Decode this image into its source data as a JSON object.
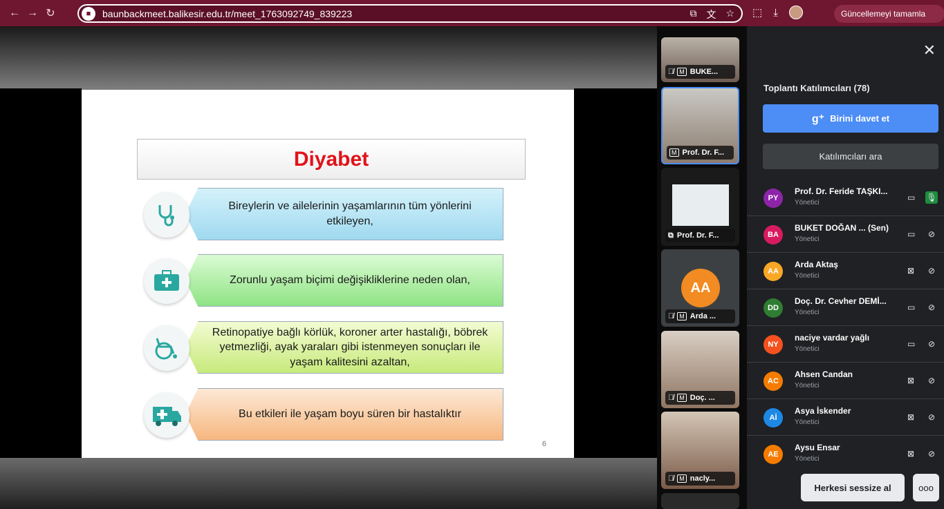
{
  "browser": {
    "url": "baunbackmeet.balikesir.edu.tr/meet_1763092749_839223",
    "update_label": "Güncellemeyi tamamla"
  },
  "slide": {
    "title": "Diyabet",
    "items": [
      "Bireylerin ve ailelerinin yaşamlarının tüm yönlerini etkileyen,",
      "Zorunlu yaşam biçimi değişikliklerine neden olan,",
      "Retinopatiye bağlı körlük, koroner arter hastalığı, böbrek yetmezliği, ayak yaraları gibi istenmeyen sonuçları ile yaşam kalitesini azaltan,",
      "Bu etkileri ile yaşam boyu süren bir hastalıktır"
    ],
    "page": "6"
  },
  "tiles": [
    {
      "name": "BUKE..."
    },
    {
      "name": "Prof. Dr. F..."
    },
    {
      "name": "Prof. Dr. F..."
    },
    {
      "name": "Arda ...",
      "initials": "AA"
    },
    {
      "name": "Doç. ..."
    },
    {
      "name": "nacly..."
    }
  ],
  "sidebar": {
    "title": "Toplantı Katılımcıları (78)",
    "invite_label": "Birini davet et",
    "search_label": "Katılımcıları ara",
    "mute_all_label": "Herkesi sessize al",
    "more_label": "ooo",
    "participants": [
      {
        "initials": "PY",
        "name": "Prof. Dr. Feride TAŞKI...",
        "role": "Yönetici",
        "color": "#8e24aa"
      },
      {
        "initials": "BA",
        "name": "BUKET DOĞAN ... (Sen)",
        "role": "Yönetici",
        "color": "#d81b60"
      },
      {
        "initials": "AA",
        "name": "Arda Aktaş",
        "role": "Yönetici",
        "color": "#f9a825"
      },
      {
        "initials": "DD",
        "name": "Doç. Dr. Cevher DEMİ...",
        "role": "Yönetici",
        "color": "#2e7d32"
      },
      {
        "initials": "NY",
        "name": "naciye vardar yağlı",
        "role": "Yönetici",
        "color": "#f4511e"
      },
      {
        "initials": "AC",
        "name": "Ahsen Candan",
        "role": "Yönetici",
        "color": "#f57c00"
      },
      {
        "initials": "Aİ",
        "name": "Asya İskender",
        "role": "Yönetici",
        "color": "#1e88e5"
      },
      {
        "initials": "AE",
        "name": "Aysu Ensar",
        "role": "Yönetici",
        "color": "#f57c00"
      }
    ]
  }
}
